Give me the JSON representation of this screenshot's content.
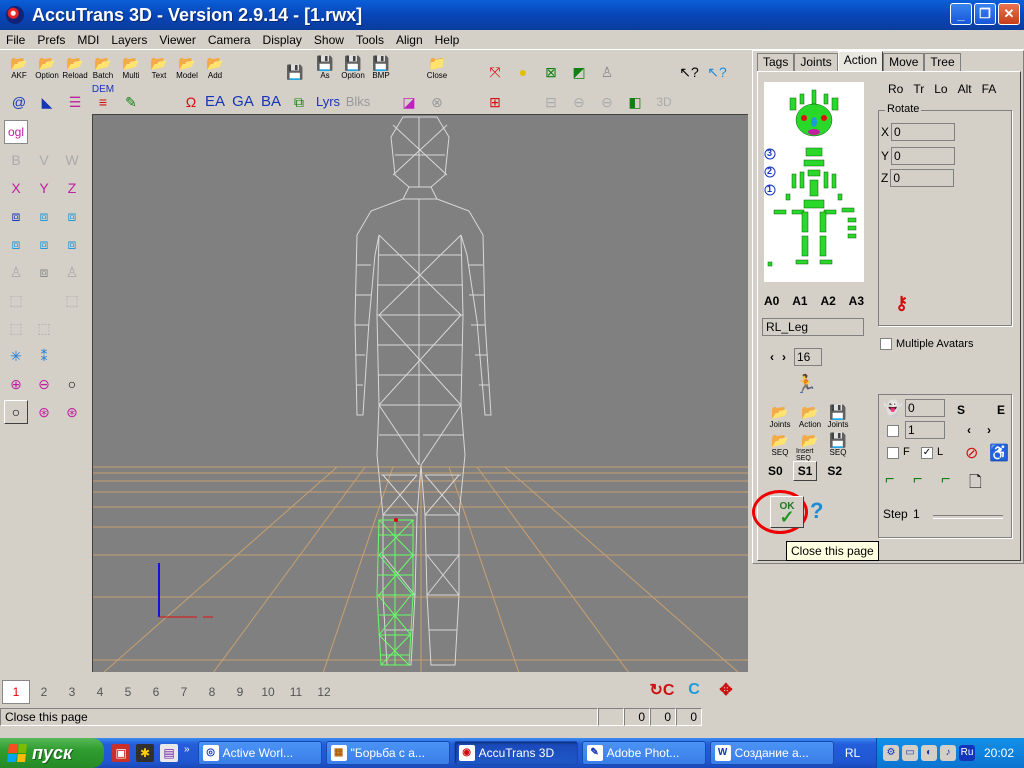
{
  "window": {
    "title": "AccuTrans 3D - Version 2.9.14 - [1.rwx]"
  },
  "menu": [
    "File",
    "Prefs",
    "MDI",
    "Layers",
    "Viewer",
    "Camera",
    "Display",
    "Show",
    "Tools",
    "Align",
    "Help"
  ],
  "toolbar": {
    "row1": [
      {
        "icon": "open-folder-icon",
        "label": "AKF"
      },
      {
        "icon": "open-folder-icon",
        "label": "Option"
      },
      {
        "icon": "open-folder-icon",
        "label": "Reload"
      },
      {
        "icon": "open-folder-icon",
        "label": "Batch"
      },
      {
        "icon": "open-folder-icon",
        "label": "Multi"
      },
      {
        "icon": "open-folder-icon",
        "label": "Text"
      },
      {
        "icon": "open-folder-icon",
        "label": "Model"
      },
      {
        "icon": "open-folder-icon",
        "label": "Add"
      },
      {
        "icon": "floppy-disk-icon",
        "label": ""
      },
      {
        "icon": "floppy-disk-icon",
        "label": "As"
      },
      {
        "icon": "floppy-disk-icon",
        "label": "Option"
      },
      {
        "icon": "floppy-disk-icon",
        "label": "BMP"
      },
      {
        "icon": "close-folder-icon",
        "label": "Close"
      }
    ],
    "row2_text": [
      "EA",
      "GA",
      "BA",
      "Lyrs",
      "Blks"
    ],
    "dem_label": "DEM",
    "zoom3d_label": "3D"
  },
  "left_tools": {
    "ogl_label": "ogl",
    "rot_labels": [
      "X",
      "Y",
      "Z"
    ],
    "cb_labels": [
      "B",
      "V",
      "W"
    ]
  },
  "frame_tabs": [
    "1",
    "2",
    "3",
    "4",
    "5",
    "6",
    "7",
    "8",
    "9",
    "10",
    "11",
    "12"
  ],
  "active_frame": "1",
  "status": {
    "text": "Close this page",
    "values": [
      "0",
      "0",
      "0"
    ]
  },
  "right_panel": {
    "tabs": [
      "Tags",
      "Joints",
      "Action",
      "Move",
      "Tree"
    ],
    "active_tab": "Action",
    "levels": [
      "3",
      "2",
      "1"
    ],
    "avatars": [
      "A0",
      "A1",
      "A2",
      "A3"
    ],
    "part_name": "RL_Leg",
    "frame_number": "16",
    "file_buttons": [
      {
        "icon": "open-folder-icon",
        "label": "Joints"
      },
      {
        "icon": "open-folder-icon",
        "label": "Action"
      },
      {
        "icon": "floppy-disk-icon",
        "label": "Joints"
      },
      {
        "icon": "open-folder-icon",
        "label": "SEQ"
      },
      {
        "icon": "open-folder-icon",
        "label": "Insert SEQ"
      },
      {
        "icon": "floppy-disk-icon",
        "label": "SEQ"
      }
    ],
    "seq_tabs": [
      "S0",
      "S1",
      "S2"
    ],
    "ok_label": "OK",
    "mode_buttons": [
      "Ro",
      "Tr",
      "Lo",
      "Alt",
      "FA"
    ],
    "rotate": {
      "title": "Rotate",
      "x": "0",
      "y": "0",
      "z": "0"
    },
    "multiple_avatars_label": "Multiple Avatars",
    "anim": {
      "field_a": "0",
      "field_b": "1",
      "s_label": "S",
      "e_label": "E",
      "f_label": "F",
      "l_label": "L",
      "l_checked": true,
      "step_label": "Step",
      "step_value": "1"
    }
  },
  "tooltip": "Close this page",
  "taskbar": {
    "start_label": "пуск",
    "tasks": [
      {
        "icon": "globe-icon",
        "label": "Active Worl..."
      },
      {
        "icon": "picture-icon",
        "label": "\"Борьба с а..."
      },
      {
        "icon": "accutrans-icon",
        "label": "AccuTrans 3D"
      },
      {
        "icon": "photoshop-icon",
        "label": "Adobe Phot..."
      },
      {
        "icon": "word-icon",
        "label": "Создание а..."
      }
    ],
    "active_task": 2,
    "lang": "RL",
    "tray_lang": "Ru",
    "clock": "20:02"
  },
  "colors": {
    "viewport": "#808080",
    "grid": "#c8a070",
    "mesh": "#d8d8d8",
    "selected_mesh": "#66ff66",
    "ring": "#e00000"
  }
}
